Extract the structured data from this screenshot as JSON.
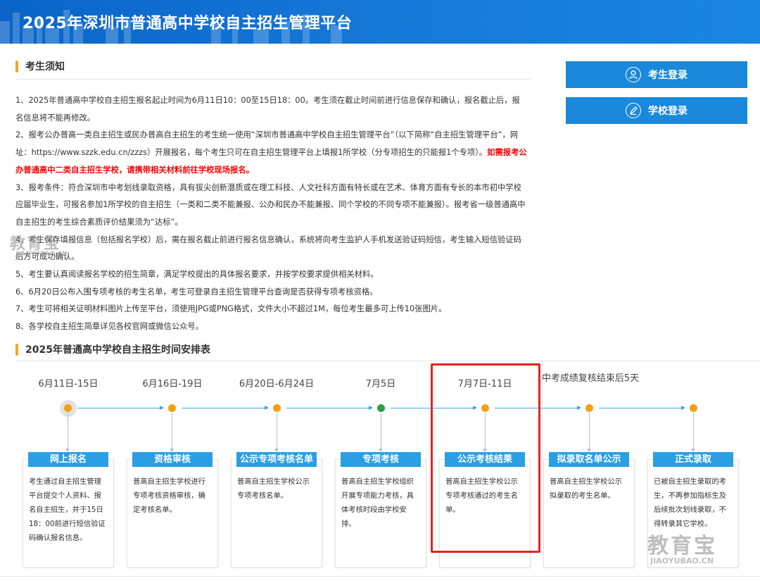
{
  "header": {
    "title": "2025年深圳市普通高中学校自主招生管理平台"
  },
  "notice": {
    "title": "考生须知",
    "items": [
      {
        "text": "1、2025年普通高中学校自主招生报名起止时间为6月11日10：00至15日18：00。考生须在截止时间前进行信息保存和确认，报名截止后，报名信息将不能再修改。"
      },
      {
        "text": "2、报考公办普高一类自主招生或民办普高自主招生的考生统一使用“深圳市普通高中学校自主招生管理平台”（以下简称“自主招生管理平台”，网址：https://www.szzk.edu.cn/zzzs）开展报名，每个考生只可在自主招生管理平台上填报1所学校（分专项招生的只能报1个专项）。",
        "red": "如需报考公办普通高中二类自主招生学校，请携带相关材料前往学校现场报名。"
      },
      {
        "text": "3、报考条件：符合深圳市中考划线录取资格，具有拔尖创新潜质或在理工科技、人文社科方面有特长或在艺术、体育方面有专长的本市初中学校应届毕业生，可报名参加1所学校的自主招生（一类和二类不能兼报、公办和民办不能兼报、同个学校的不同专项不能兼报）。报考省一级普通高中自主招生的考生综合素质评价结果须为“达标”。"
      },
      {
        "text": "4、考生保存填报信息（包括报名学校）后，需在报名截止前进行报名信息确认，系统将向考生监护人手机发送验证码短信，考生输入短信验证码后方可成功确认。"
      },
      {
        "text": "5、考生要认真阅读报名学校的招生简章，满足学校提出的具体报名要求，并按学校要求提供相关材料。"
      },
      {
        "text": "6、6月20日公布入围专项考核的考生名单，考生可登录自主招生管理平台查询是否获得专项考核资格。"
      },
      {
        "text": "7、考生可将相关证明材料图片上传至平台，须使用JPG或PNG格式，文件大小不超过1M，每位考生最多可上传10张图片。"
      },
      {
        "text": "8、各学校自主招生简章详见各校官网或微信公众号。"
      }
    ]
  },
  "login": {
    "student": "考生登录",
    "school": "学校登录"
  },
  "schedule": {
    "title": "2025年普通高中学校自主招生时间安排表",
    "steps": [
      {
        "date": "6月11日-15日",
        "label": "网上报名",
        "desc": "考生通过自主招生管理平台提交个人资料、报名自主招生，并于15日18：00前进行短信验证码确认报名信息。",
        "dot": "orange"
      },
      {
        "date": "6月16日-19日",
        "label": "资格审核",
        "desc": "普高自主招生学校进行专项考核资格审核，确定考核名单。",
        "dot": "orange"
      },
      {
        "date": "6月20日-6月24日",
        "label": "公示专项考核名单",
        "desc": "普高自主招生学校公示专项考核名单。",
        "dot": "orange"
      },
      {
        "date": "7月5日",
        "label": "专项考核",
        "desc": "普高自主招生学校组织开展专项能力考核，具体考核时段由学校安排。",
        "dot": "green"
      },
      {
        "date": "7月7日-11日",
        "label": "公示考核结果",
        "desc": "普高自主招生学校公示专项考核通过的考生名单。",
        "dot": "orange"
      },
      {
        "date": "中考成绩复核结束后5天",
        "label": "拟录取名单公示",
        "desc": "普高自主招生学校公示拟录取的考生名单。",
        "dot": "orange"
      },
      {
        "date": "",
        "label": "正式录取",
        "desc": "已被自主招生录取的考生，不再参加指标生及后续批次划线录取，不得转录其它学校。",
        "dot": "orange"
      }
    ]
  },
  "watermark": {
    "logo": "教育宝",
    "url": "JIAOYUBAO.CN"
  },
  "colors": {
    "header": "#1576d6",
    "accent": "#f5a623",
    "button": "#1a88db",
    "label": "#2a9fe3",
    "highlight": "#e8231e",
    "green": "#2aa345"
  }
}
